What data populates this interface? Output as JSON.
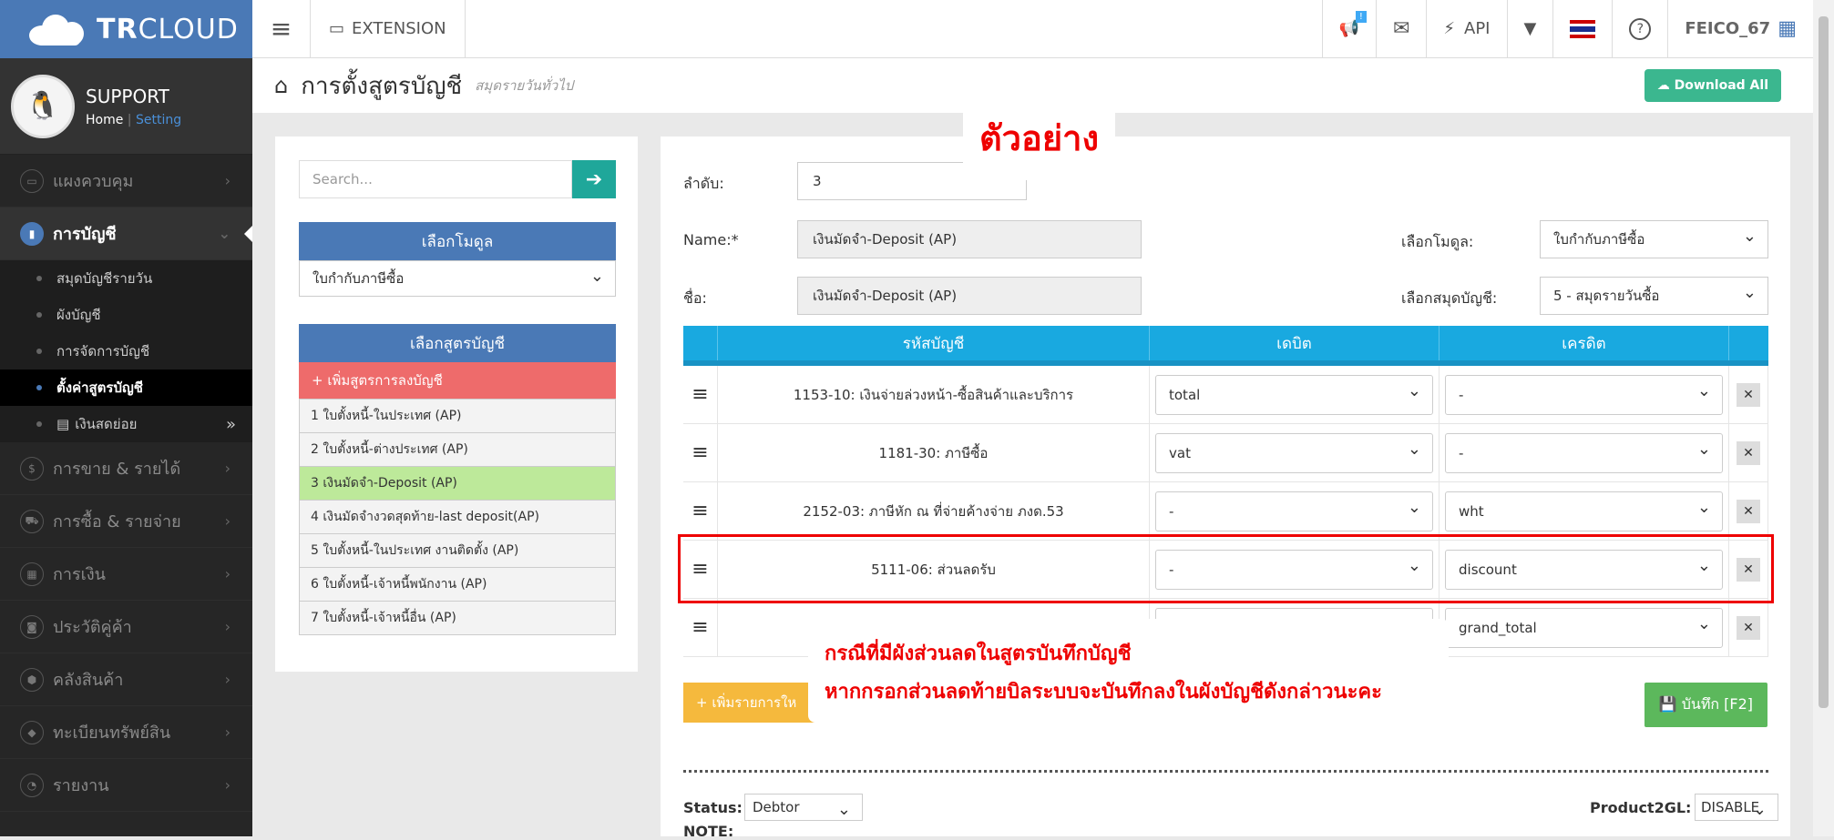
{
  "brand": {
    "bold": "TR",
    "light": "CLOUD"
  },
  "profile": {
    "name": "SUPPORT",
    "home": "Home",
    "sep": "|",
    "setting": "Setting"
  },
  "sidebar": {
    "items": [
      {
        "label": "แผงควบคุม",
        "icon": "monitor-icon"
      },
      {
        "label": "การบัญชี",
        "icon": "book-icon",
        "active": true
      },
      {
        "label": "การขาย & รายได้",
        "icon": "dollar-icon"
      },
      {
        "label": "การซื้อ & รายจ่าย",
        "icon": "cart-icon"
      },
      {
        "label": "การเงิน",
        "icon": "calendar-icon"
      },
      {
        "label": "ประวัติคู่ค้า",
        "icon": "contact-icon"
      },
      {
        "label": "คลังสินค้า",
        "icon": "box-icon"
      },
      {
        "label": "ทะเบียนทรัพย์สิน",
        "icon": "diamond-icon"
      },
      {
        "label": "รายงาน",
        "icon": "report-icon"
      }
    ],
    "subitems": [
      "สมุดบัญชีรายวัน",
      "ผังบัญชี",
      "การจัดการบัญชี",
      "ตั้งค่าสูตรบัญชี",
      "เงินสดย่อย"
    ]
  },
  "topbar": {
    "extension": "EXTENSION",
    "badge": "!",
    "api": "API",
    "user": "FEICO_67"
  },
  "header": {
    "title": "การตั้งสูตรบัญชี",
    "subtitle": "สมุดรายวันทั่วไป",
    "download": "Download All"
  },
  "left": {
    "search_placeholder": "Search...",
    "module_header": "เลือกโมดูล",
    "module_value": "ใบกำกับภาษีซื้อ",
    "formula_header": "เลือกสูตรบัญชี",
    "add_formula": "+ เพิ่มสูตรการลงบัญชี",
    "formulas": [
      "1 ใบตั้งหนี้-ในประเทศ (AP)",
      "2 ใบตั้งหนี้-ต่างประเทศ (AP)",
      "3 เงินมัดจำ-Deposit (AP)",
      "4 เงินมัดจำงวดสุดท้าย-last deposit(AP)",
      "5 ใบตั้งหนี้-ในประเทศ งานติดตั้ง (AP)",
      "6 ใบตั้งหนี้-เจ้าหนี้พนักงาน (AP)",
      "7 ใบตั้งหนี้-เจ้าหนี้อื่น (AP)"
    ]
  },
  "form": {
    "order_label": "ลำดับ:",
    "order_value": "3",
    "name_label": "Name:*",
    "name_value": "เงินมัดจำ-Deposit (AP)",
    "thai_name_label": "ชื่อ:",
    "thai_name_value": "เงินมัดจำ-Deposit (AP)",
    "module_label": "เลือกโมดูล:",
    "module_value": "ใบกำกับภาษีซื้อ",
    "journal_label": "เลือกสมุดบัญชี:",
    "journal_value": "5 - สมุดรายวันซื้อ"
  },
  "table": {
    "headers": [
      "รหัสบัญชี",
      "เดบิต",
      "เครดิต"
    ],
    "rows": [
      {
        "code": "1153-10: เงินจ่ายล่วงหน้า-ซื้อสินค้าและบริการ",
        "debit": "total",
        "credit": "-"
      },
      {
        "code": "1181-30: ภาษีซื้อ",
        "debit": "vat",
        "credit": "-"
      },
      {
        "code": "2152-03: ภาษีหัก ณ ที่จ่ายค้างจ่าย ภงด.53",
        "debit": "-",
        "credit": "wht"
      },
      {
        "code": "5111-06: ส่วนลดรับ",
        "debit": "-",
        "credit": "discount"
      },
      {
        "code": "",
        "debit": "",
        "credit": "grand_total"
      }
    ]
  },
  "buttons": {
    "add_row": "+ เพิ่มรายการให",
    "save": "บันทึก [F2]"
  },
  "footer": {
    "status_label": "Status:",
    "status_value": "Debtor",
    "note_label": "NOTE:",
    "p2gl_label": "Product2GL:",
    "p2gl_value": "DISABLE"
  },
  "annotation": {
    "example": "ตัวอย่าง",
    "line1": "กรณีที่มีผังส่วนลดในสูตรบันทึกบัญชี",
    "line2": "หากกรอกส่วนลดท้ายบิลระบบจะบันทึกลงในผังบัญชีดังกล่าวนะคะ"
  }
}
